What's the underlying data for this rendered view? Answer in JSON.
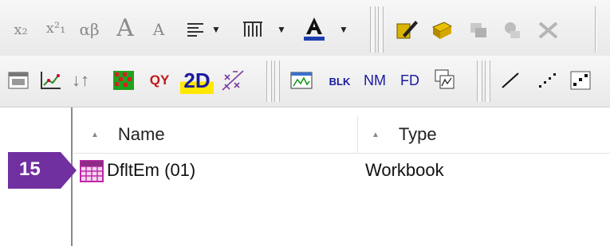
{
  "toolbar_row1": {
    "subscript_label": "x₂",
    "superscript_label": "x²₁",
    "greek_label": "αβ",
    "font_bigger_label": "A",
    "font_smaller_label": "A"
  },
  "toolbar_row2": {
    "qy_label": "QY",
    "twod_label": "2D",
    "blk_label": "BLK",
    "nm_label": "NM",
    "fd_label": "FD"
  },
  "tree": {
    "columns": [
      {
        "label": "Name"
      },
      {
        "label": "Type"
      }
    ],
    "rows": [
      {
        "name": "DfltEm (01)",
        "type": "Workbook"
      }
    ]
  },
  "callout": {
    "number": "15",
    "color": "#7030a0"
  },
  "colors": {
    "callout": "#7030a0",
    "workbook_icon": "#c026a8"
  }
}
